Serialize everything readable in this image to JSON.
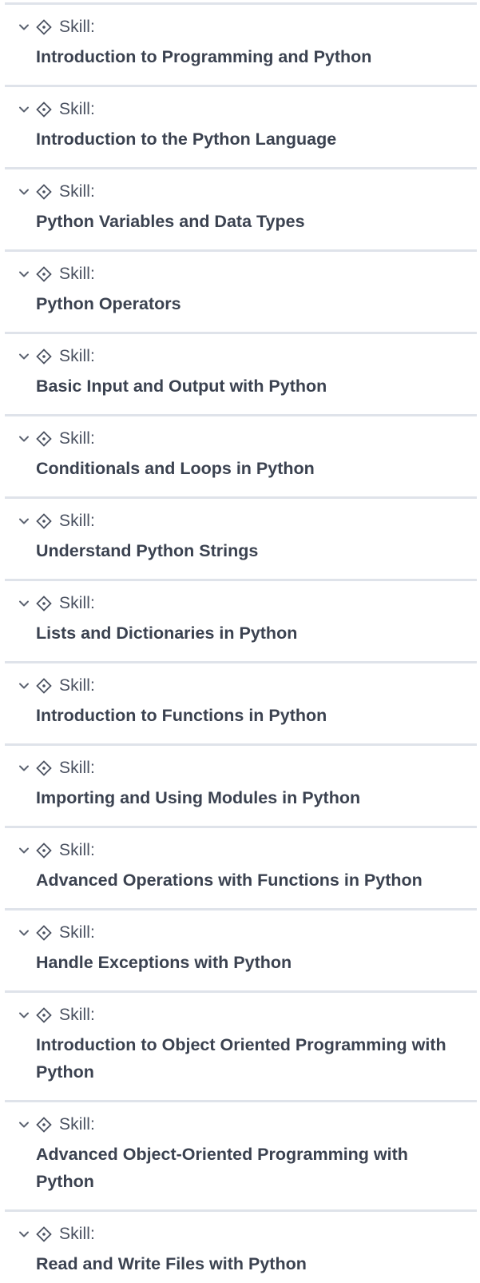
{
  "skills": {
    "label": "Skill:",
    "items": [
      {
        "title": "Introduction to Programming and Python"
      },
      {
        "title": "Introduction to the Python Language"
      },
      {
        "title": "Python Variables and Data Types"
      },
      {
        "title": "Python Operators"
      },
      {
        "title": "Basic Input and Output with Python"
      },
      {
        "title": "Conditionals and Loops in Python"
      },
      {
        "title": "Understand Python Strings"
      },
      {
        "title": "Lists and Dictionaries in Python"
      },
      {
        "title": "Introduction to Functions in Python"
      },
      {
        "title": "Importing and Using Modules in Python"
      },
      {
        "title": "Advanced Operations with Functions in Python"
      },
      {
        "title": "Handle Exceptions with Python"
      },
      {
        "title": "Introduction to Object Oriented Programming with Python"
      },
      {
        "title": "Advanced Object-Oriented Programming with Python"
      },
      {
        "title": "Read and Write Files with Python"
      }
    ]
  },
  "icons": {
    "expand": "chevron-down-icon",
    "skill": "skill-diamond-icon"
  },
  "colors": {
    "text": "#3b4250",
    "divider": "#dfe3ea"
  }
}
